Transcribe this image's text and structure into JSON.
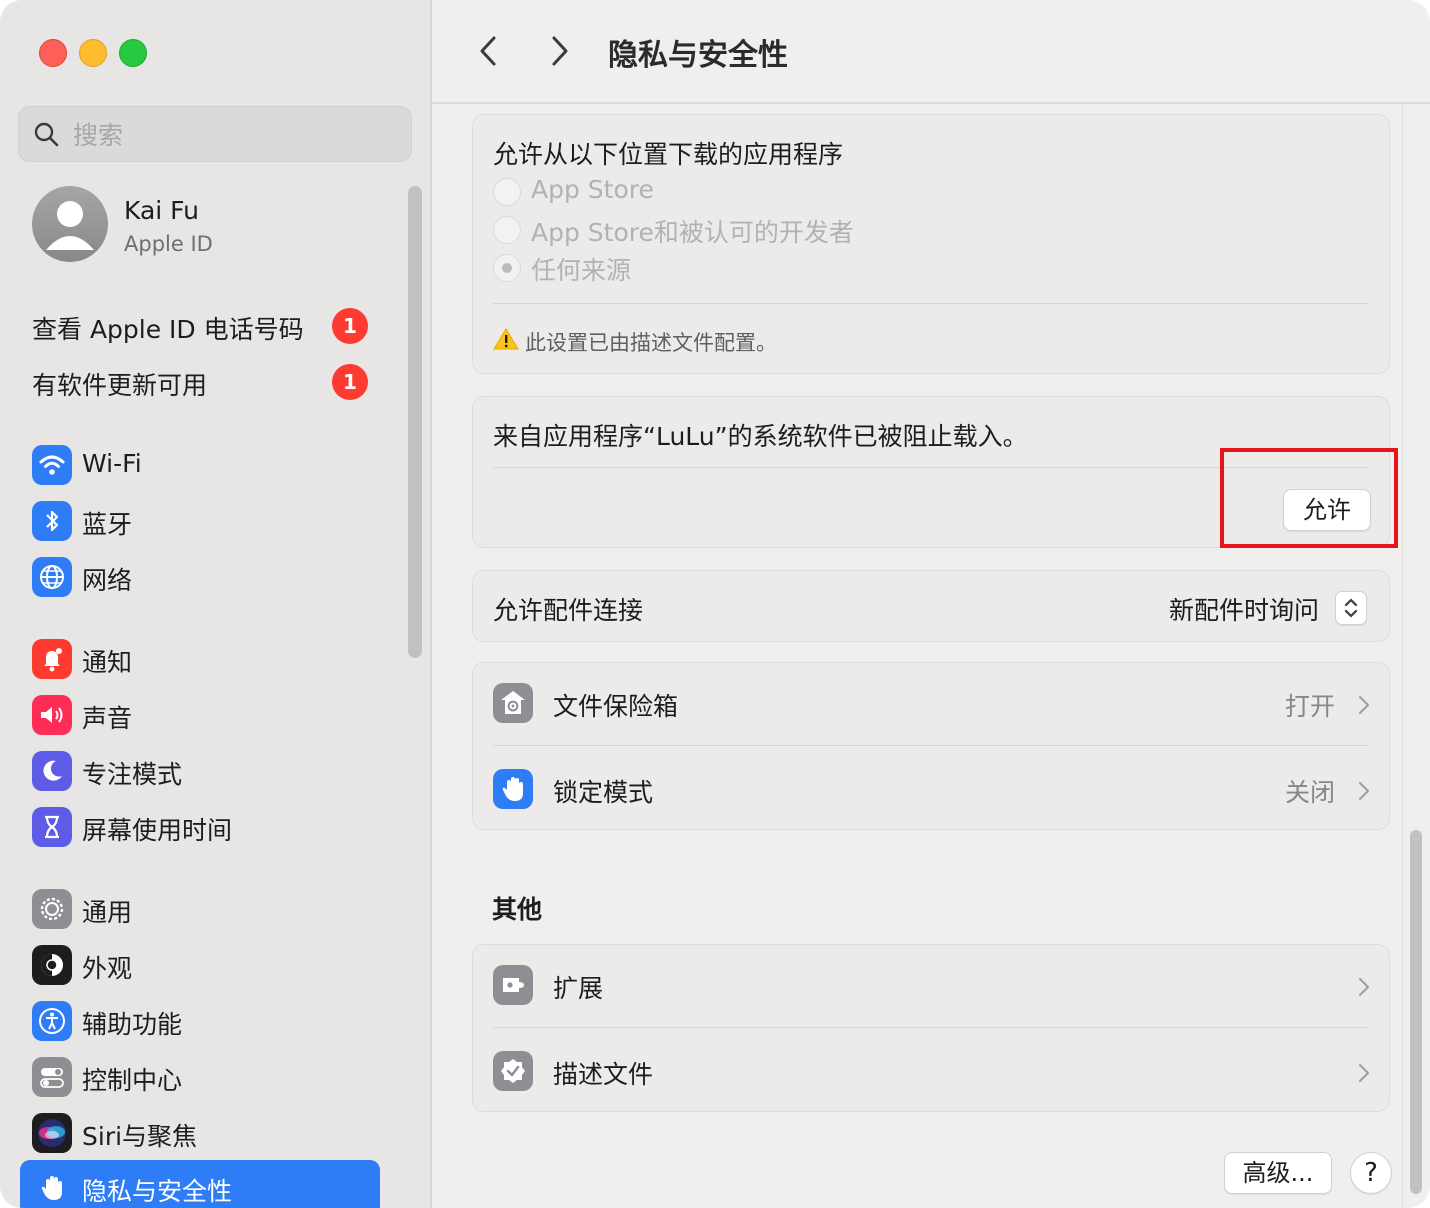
{
  "window": {
    "title": "隐私与安全性"
  },
  "sidebar": {
    "search": {
      "placeholder": "搜索",
      "value": ""
    },
    "profile": {
      "name": "Kai Fu",
      "subtitle": "Apple ID"
    },
    "notices": [
      {
        "label": "查看 Apple ID 电话号码",
        "badge": "1"
      },
      {
        "label": "有软件更新可用",
        "badge": "1"
      }
    ],
    "items": [
      {
        "label": "Wi-Fi",
        "icon": "wifi-icon",
        "color": "#2e7cf6"
      },
      {
        "label": "蓝牙",
        "icon": "bluetooth-icon",
        "color": "#2e7cf6"
      },
      {
        "label": "网络",
        "icon": "globe-icon",
        "color": "#2e7cf6"
      },
      {
        "label": "通知",
        "icon": "bell-icon",
        "color": "#fe3b30"
      },
      {
        "label": "声音",
        "icon": "speaker-icon",
        "color": "#fe2d55"
      },
      {
        "label": "专注模式",
        "icon": "moon-icon",
        "color": "#5e5ce6"
      },
      {
        "label": "屏幕使用时间",
        "icon": "hourglass-icon",
        "color": "#5e5ce6"
      },
      {
        "label": "通用",
        "icon": "gear-icon",
        "color": "#8e8e93"
      },
      {
        "label": "外观",
        "icon": "appearance-icon",
        "color": "#1d1d1f"
      },
      {
        "label": "辅助功能",
        "icon": "accessibility-icon",
        "color": "#2e7cf6"
      },
      {
        "label": "控制中心",
        "icon": "toggles-icon",
        "color": "#8e8e93"
      },
      {
        "label": "Siri与聚焦",
        "icon": "siri-icon",
        "color": "#1d1d1f"
      },
      {
        "label": "隐私与安全性",
        "icon": "hand-icon",
        "color": "#2e7cf6",
        "selected": true
      }
    ]
  },
  "main": {
    "title": "隐私与安全性",
    "downloads": {
      "heading": "允许从以下位置下载的应用程序",
      "options": [
        {
          "label": "App Store",
          "selected": false
        },
        {
          "label": "App Store和被认可的开发者",
          "selected": false
        },
        {
          "label": "任何来源",
          "selected": true
        }
      ],
      "warning": "此设置已由描述文件配置。"
    },
    "blocked": {
      "message": "来自应用程序“LuLu”的系统软件已被阻止载入。",
      "allow_label": "允许"
    },
    "accessories": {
      "label": "允许配件连接",
      "value": "新配件时询问"
    },
    "security_rows": [
      {
        "label": "文件保险箱",
        "value": "打开",
        "icon": "filevault-icon"
      },
      {
        "label": "锁定模式",
        "value": "关闭",
        "icon": "hand-icon"
      }
    ],
    "other": {
      "heading": "其他",
      "rows": [
        {
          "label": "扩展",
          "icon": "extension-icon"
        },
        {
          "label": "描述文件",
          "icon": "profile-badge-icon"
        }
      ]
    },
    "footer": {
      "advanced_label": "高级...",
      "help_label": "?"
    }
  },
  "colors": {
    "accent": "#2e7cf6",
    "badge": "#fe3b30",
    "highlight_box": "#e8141b"
  }
}
